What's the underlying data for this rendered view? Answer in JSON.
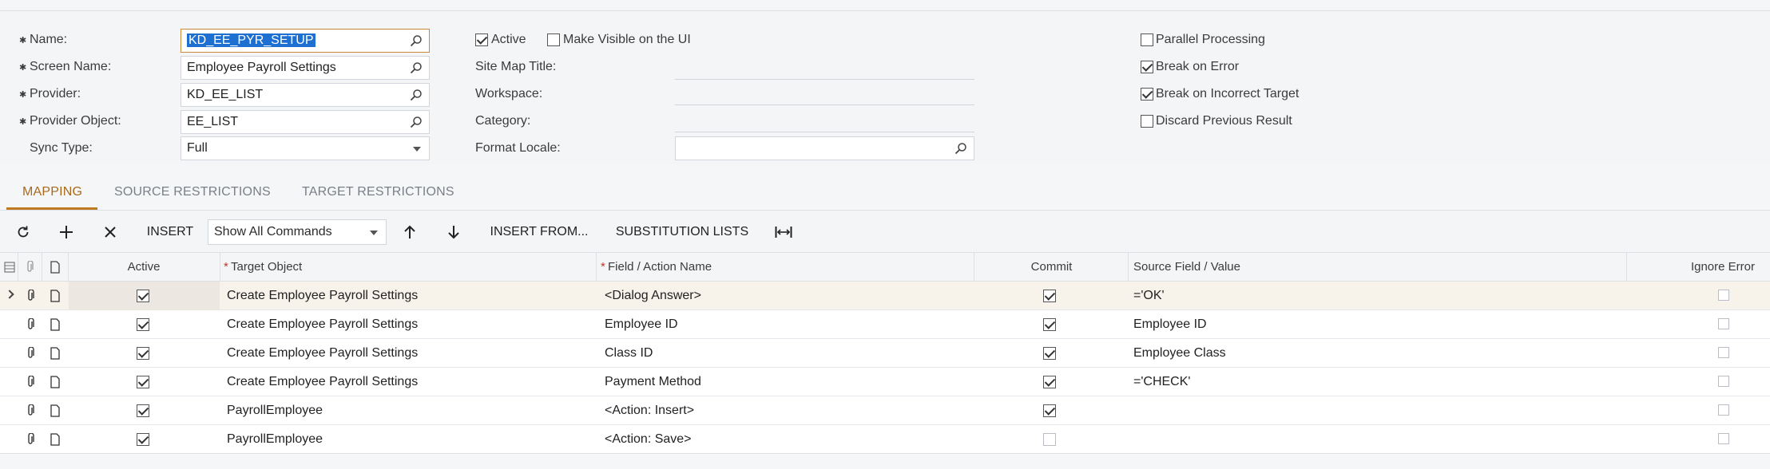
{
  "form": {
    "name_label": "Name:",
    "name_value": "KD_EE_PYR_SETUP",
    "screen_label": "Screen Name:",
    "screen_value": "Employee Payroll Settings",
    "provider_label": "Provider:",
    "provider_value": "KD_EE_LIST",
    "provider_object_label": "Provider Object:",
    "provider_object_value": "EE_LIST",
    "sync_type_label": "Sync Type:",
    "sync_type_value": "Full",
    "active_label": "Active",
    "active_checked": true,
    "visible_label": "Make Visible on the UI",
    "visible_checked": false,
    "site_map_label": "Site Map Title:",
    "site_map_value": "",
    "workspace_label": "Workspace:",
    "workspace_value": "",
    "category_label": "Category:",
    "category_value": "",
    "format_locale_label": "Format Locale:",
    "format_locale_value": "",
    "parallel_label": "Parallel Processing",
    "parallel_checked": false,
    "break_error_label": "Break on Error",
    "break_error_checked": true,
    "break_target_label": "Break on Incorrect Target",
    "break_target_checked": true,
    "discard_label": "Discard Previous Result",
    "discard_checked": false
  },
  "tabs": [
    "MAPPING",
    "SOURCE RESTRICTIONS",
    "TARGET RESTRICTIONS"
  ],
  "toolbar": {
    "insert_label": "INSERT",
    "commands_value": "Show All Commands",
    "insert_from_label": "INSERT FROM...",
    "substitution_label": "SUBSTITUTION LISTS"
  },
  "grid": {
    "headers": {
      "active": "Active",
      "target_object": "Target Object",
      "field_action": "Field / Action Name",
      "commit": "Commit",
      "source_field": "Source Field / Value",
      "ignore_error": "Ignore Error"
    },
    "rows": [
      {
        "active": true,
        "target": "Create Employee Payroll Settings",
        "field": "<Dialog Answer>",
        "commit": true,
        "source": "='OK'",
        "ignore": false
      },
      {
        "active": true,
        "target": "Create Employee Payroll Settings",
        "field": "Employee ID",
        "commit": true,
        "source": "Employee ID",
        "ignore": false
      },
      {
        "active": true,
        "target": "Create Employee Payroll Settings",
        "field": "Class ID",
        "commit": true,
        "source": "Employee Class",
        "ignore": false
      },
      {
        "active": true,
        "target": "Create Employee Payroll Settings",
        "field": "Payment Method",
        "commit": true,
        "source": "='CHECK'",
        "ignore": false
      },
      {
        "active": true,
        "target": "PayrollEmployee",
        "field": "<Action: Insert>",
        "commit": true,
        "source": "",
        "ignore": false
      },
      {
        "active": true,
        "target": "PayrollEmployee",
        "field": "<Action: Save>",
        "commit": false,
        "source": "",
        "ignore": false
      }
    ]
  },
  "colors": {
    "accent": "#c07a23",
    "selection": "#1d6fd1"
  }
}
